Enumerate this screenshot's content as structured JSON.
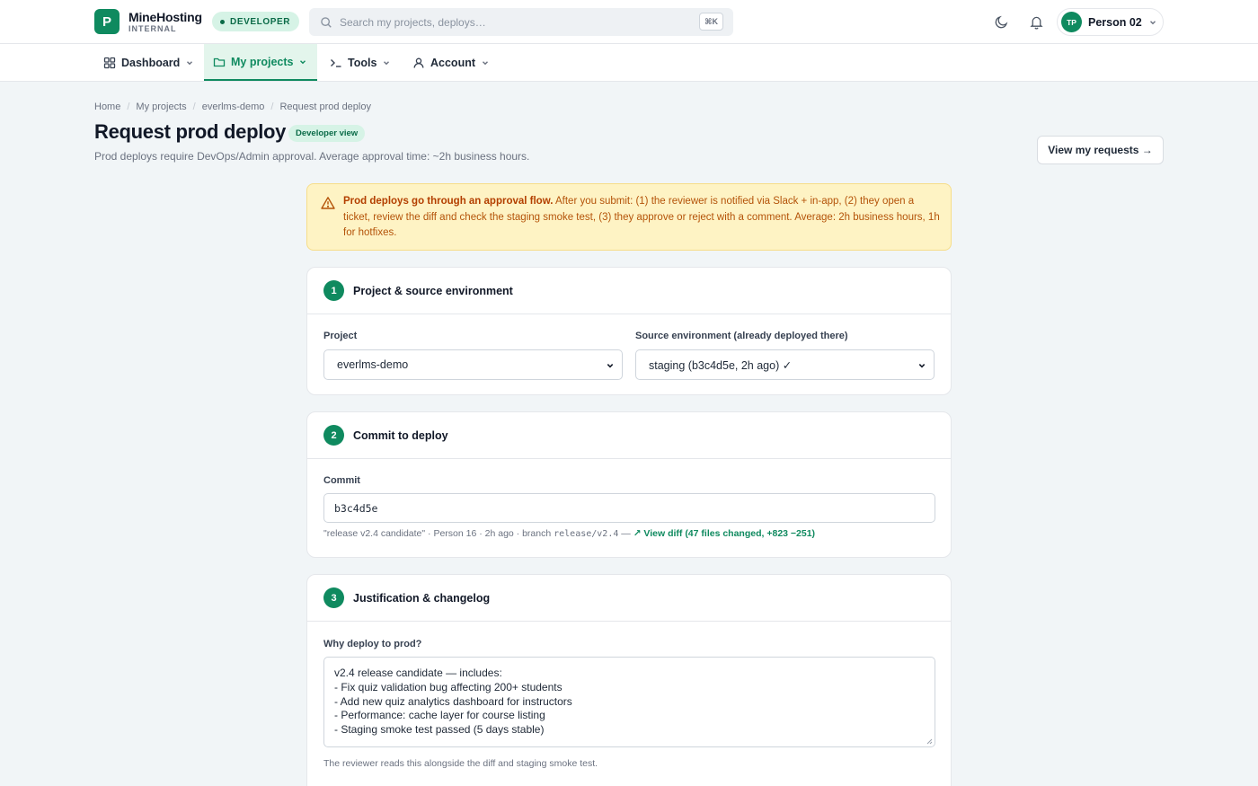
{
  "brand": {
    "logo_letter": "P",
    "name": "MineHosting",
    "sub": "INTERNAL",
    "badge": "DEVELOPER",
    "accent": "#0f8a5f"
  },
  "search": {
    "placeholder": "Search my projects, deploys…",
    "shortcut": "⌘K"
  },
  "header_icons": [
    "moon-icon",
    "bell-icon"
  ],
  "user": {
    "initials": "TP",
    "name": "Person 02"
  },
  "nav": [
    {
      "label": "Dashboard",
      "icon": "grid-icon"
    },
    {
      "label": "My projects",
      "icon": "folder-icon",
      "active": true
    },
    {
      "label": "Tools",
      "icon": "terminal-icon"
    },
    {
      "label": "Account",
      "icon": "user-icon"
    }
  ],
  "breadcrumb": [
    "Home",
    "My projects",
    "everlms-demo",
    "Request prod deploy"
  ],
  "page": {
    "title": "Request prod deploy",
    "badge": "Developer view",
    "subtitle": "Prod deploys require DevOps/Admin approval. Average approval time: ~2h business hours.",
    "view_requests": "View my requests →"
  },
  "alert": {
    "bold": "Prod deploys go through an approval flow.",
    "text": " After you submit: (1) the reviewer is notified via Slack + in-app, (2) they open a ticket, review the diff and check the staging smoke test, (3) they approve or reject with a comment. Average: 2h business hours, 1h for hotfixes."
  },
  "step1": {
    "num": "1",
    "title": "Project & source environment",
    "project_label": "Project",
    "project_value": "everlms-demo",
    "source_label": "Source environment (already deployed there)",
    "source_value": "staging (b3c4d5e, 2h ago) ✓"
  },
  "step2": {
    "num": "2",
    "title": "Commit to deploy",
    "commit_label": "Commit",
    "commit_value": "b3c4d5e",
    "meta_prefix": "\"release v2.4 candidate\" · Person 16 · 2h ago · branch ",
    "meta_branch": "release/v2.4",
    "meta_sep": " — ",
    "meta_link": "↗ View diff (47 files changed, +823 −251)"
  },
  "step3": {
    "num": "3",
    "title": "Justification & changelog",
    "why_label": "Why deploy to prod?",
    "lines": [
      "v2.4 release candidate — includes:",
      "- Fix quiz validation bug affecting 200+ students",
      "- Add new quiz analytics dashboard for instructors",
      "- Performance: cache layer for course listing",
      "- Staging smoke test passed (5 days stable)"
    ],
    "hint": "The reviewer reads this alongside the diff and staging smoke test."
  }
}
